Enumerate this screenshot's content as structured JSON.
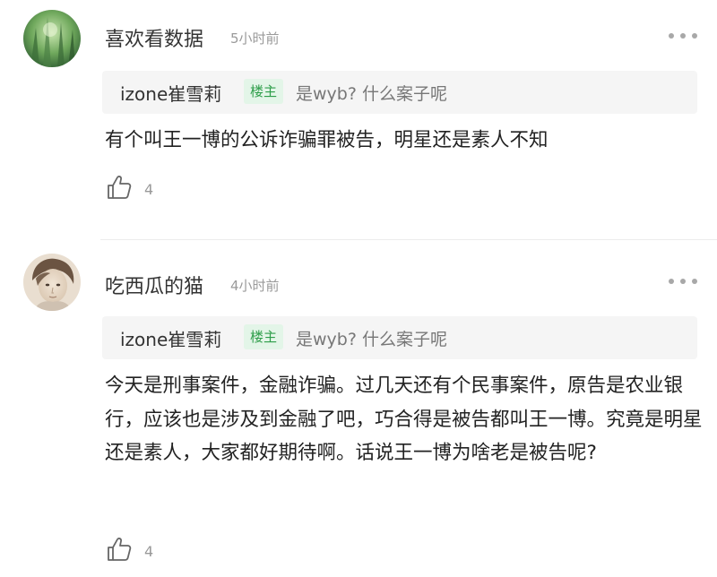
{
  "comments": [
    {
      "username": "喜欢看数据",
      "time": "5小时前",
      "avatar": "forest-avatar",
      "reply_to": {
        "username": "izone崔雪莉",
        "badge": "楼主",
        "text": "是wyb? 什么案子呢"
      },
      "text": "有个叫王一博的公诉诈骗罪被告，明星还是素人不知",
      "likes": "4"
    },
    {
      "username": "吃西瓜的猫",
      "time": "4小时前",
      "avatar": "portrait-avatar",
      "reply_to": {
        "username": "izone崔雪莉",
        "badge": "楼主",
        "text": "是wyb? 什么案子呢"
      },
      "text": "今天是刑事案件，金融诈骗。过几天还有个民事案件，原告是农业银行，应该也是涉及到金融了吧，巧合得是被告都叫王一博。究竟是明星还是素人，大家都好期待啊。话说王一博为啥老是被告呢?",
      "likes": "4"
    }
  ],
  "colors": {
    "badge_text": "#2e9e4a",
    "badge_bg": "#e3f5e8",
    "quote_bg": "#f5f5f5",
    "meta_gray": "#9a9a9a"
  },
  "icons": {
    "more": "more-dots-icon",
    "like": "thumbs-up-icon"
  }
}
